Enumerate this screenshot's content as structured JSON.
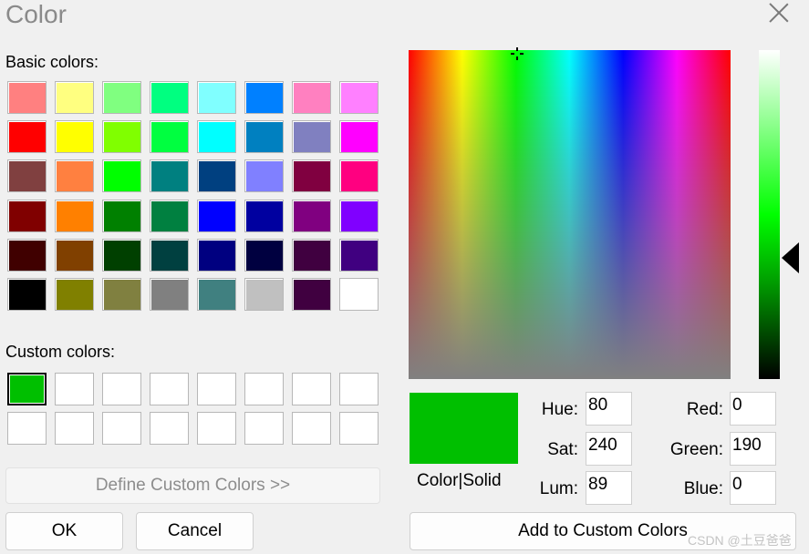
{
  "window": {
    "title": "Color"
  },
  "basic_colors_label": "Basic colors:",
  "basic_colors": [
    [
      "#ff8080",
      "#ffff80",
      "#80ff80",
      "#00ff80",
      "#80ffff",
      "#0080ff",
      "#ff80c0",
      "#ff80ff"
    ],
    [
      "#ff0000",
      "#ffff00",
      "#80ff00",
      "#00ff40",
      "#00ffff",
      "#0080c0",
      "#8080c0",
      "#ff00ff"
    ],
    [
      "#804040",
      "#ff8040",
      "#00ff00",
      "#008080",
      "#004080",
      "#8080ff",
      "#800040",
      "#ff0080"
    ],
    [
      "#800000",
      "#ff8000",
      "#008000",
      "#008040",
      "#0000ff",
      "#0000a0",
      "#800080",
      "#8000ff"
    ],
    [
      "#400000",
      "#804000",
      "#004000",
      "#004040",
      "#000080",
      "#000040",
      "#400040",
      "#400080"
    ],
    [
      "#000000",
      "#808000",
      "#808040",
      "#808080",
      "#408080",
      "#c0c0c0",
      "#400040",
      "#ffffff"
    ]
  ],
  "custom_colors_label": "Custom colors:",
  "custom_colors": [
    [
      "#00bf00",
      "#ffffff",
      "#ffffff",
      "#ffffff",
      "#ffffff",
      "#ffffff",
      "#ffffff",
      "#ffffff"
    ],
    [
      "#ffffff",
      "#ffffff",
      "#ffffff",
      "#ffffff",
      "#ffffff",
      "#ffffff",
      "#ffffff",
      "#ffffff"
    ]
  ],
  "buttons": {
    "define_custom": "Define Custom Colors >>",
    "ok": "OK",
    "cancel": "Cancel",
    "add_custom": "Add to Custom Colors"
  },
  "preview": {
    "label": "Color|Solid",
    "color": "#00bf00"
  },
  "fields": {
    "hue_label": "Hue:",
    "hue": "80",
    "sat_label": "Sat:",
    "sat": "240",
    "lum_label": "Lum:",
    "lum": "89",
    "red_label": "Red:",
    "red": "0",
    "green_label": "Green:",
    "green": "190",
    "blue_label": "Blue:",
    "blue": "0"
  },
  "watermark": "CSDN @土豆爸爸"
}
